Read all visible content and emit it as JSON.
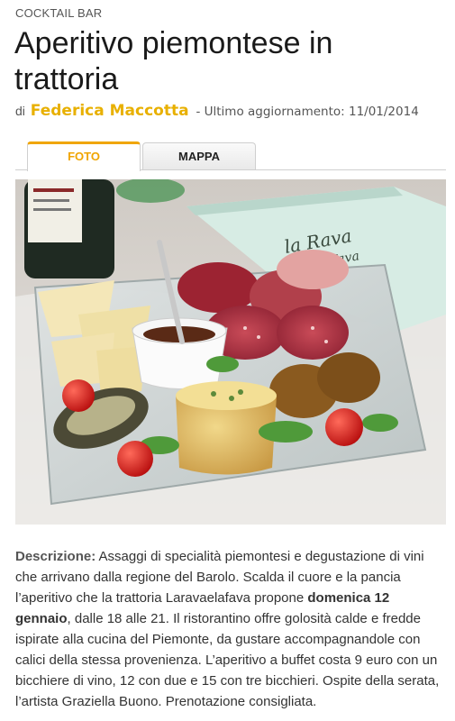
{
  "article": {
    "category": "COCKTAIL BAR",
    "title": "Aperitivo piemontese in trattoria",
    "byline_prefix": "di",
    "author": "Federica Maccotta",
    "updated": "- Ultimo aggiornamento: 11/01/2014"
  },
  "tabs": [
    {
      "label": "FOTO",
      "active": true
    },
    {
      "label": "MAPPA",
      "active": false
    }
  ],
  "photo": {
    "menu_text": "la Rava e la Fava"
  },
  "description": {
    "label": "Descrizione:",
    "part1": " Assaggi di specialità piemontesi e degustazione di vini che arrivano dalla regione del Barolo. Scalda il cuore e la pancia l’aperitivo che la trattoria Laravaelafava propone ",
    "bold": "domenica 12 gennaio",
    "part2": ", dalle 18 alle 21. Il ristorantino offre golosità calde e fredde ispirate alla cucina del Piemonte, da gustare accompagnandole con calici della stessa provenienza. L’aperitivo a buffet costa 9 euro con un bicchiere di vino, 12 con due e 15 con tre bicchieri. Ospite della serata, l’artista Graziella Buono. Prenotazione consigliata."
  },
  "colors": {
    "accent": "#f0a500",
    "author": "#e8b000"
  }
}
